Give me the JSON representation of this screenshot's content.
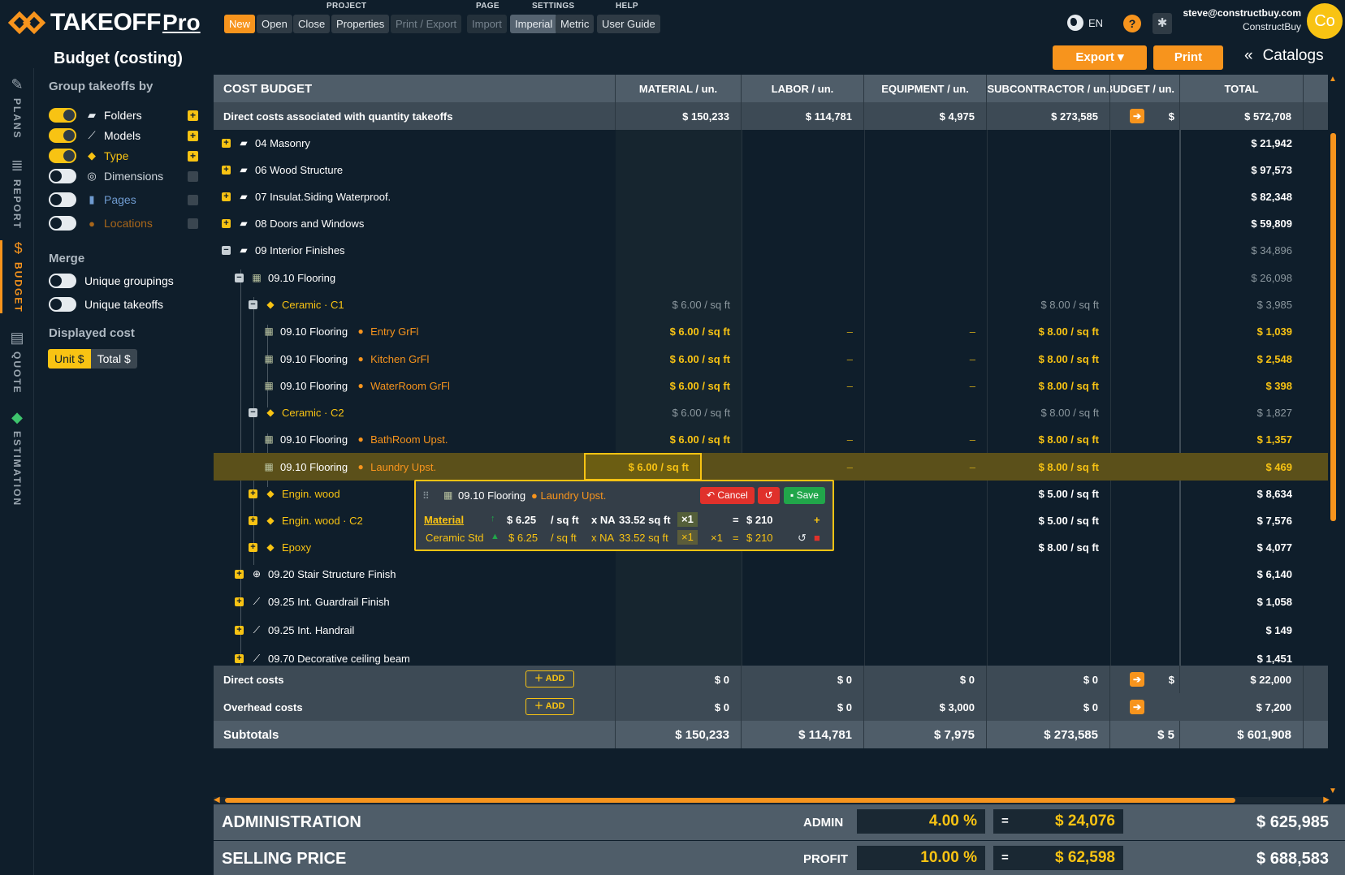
{
  "app": {
    "brand": "TAKEOFF",
    "brand_suffix": "Pro"
  },
  "menu": {
    "groups": {
      "project": "PROJECT",
      "page": "PAGE",
      "settings": "SETTINGS",
      "help": "HELP"
    },
    "buttons": {
      "new": "New",
      "open": "Open",
      "close": "Close",
      "properties": "Properties",
      "print_export": "Print / Export",
      "import": "Import",
      "imperial": "Imperial",
      "metric": "Metric",
      "user_guide": "User Guide"
    },
    "language": "EN",
    "help_glyph": "?"
  },
  "user": {
    "email": "steve@constructbuy.com",
    "company": "ConstructBuy",
    "initials": "Co"
  },
  "rail": {
    "plans": "PLANS",
    "report": "REPORT",
    "budget": "BUDGET",
    "quote": "QUOTE",
    "estimation": "ESTIMATION"
  },
  "side": {
    "title": "Budget (costing)",
    "group_by_label": "Group takeoffs by",
    "group_by": [
      {
        "label": "Folders",
        "on": true,
        "icon": "folder-icon"
      },
      {
        "label": "Models",
        "on": true,
        "icon": "model-icon"
      },
      {
        "label": "Type",
        "on": true,
        "icon": "tag-icon"
      },
      {
        "label": "Dimensions",
        "on": false,
        "icon": "dimension-icon"
      },
      {
        "label": "Pages",
        "on": false,
        "icon": "page-icon"
      },
      {
        "label": "Locations",
        "on": false,
        "icon": "location-icon"
      }
    ],
    "merge_label": "Merge",
    "merge": [
      {
        "label": "Unique groupings",
        "on": false
      },
      {
        "label": "Unique takeoffs",
        "on": false
      }
    ],
    "displayed_cost_label": "Displayed cost",
    "cost_options": [
      "Unit $",
      "Total $"
    ]
  },
  "actions": {
    "export": "Export",
    "print": "Print",
    "catalogs": "Catalogs"
  },
  "table": {
    "headers": {
      "name": "COST BUDGET",
      "material": "MATERIAL / un.",
      "labor": "LABOR / un.",
      "equipment": "EQUIPMENT / un.",
      "subcontractor": "SUBCONTRACTOR / un.",
      "budget": "BUDGET / un.",
      "total": "TOTAL"
    },
    "summary": {
      "label": "Direct costs associated with quantity takeoffs",
      "material": "$ 150,233",
      "labor": "$ 114,781",
      "equipment": "$ 4,975",
      "subcontractor": "$ 273,585",
      "budget": "$",
      "total": "$ 572,708"
    },
    "rows": [
      {
        "label": "04 Masonry",
        "total": "$ 21,942"
      },
      {
        "label": "06 Wood Structure",
        "total": "$ 97,573"
      },
      {
        "label": "07 Insulat.Siding Waterproof.",
        "total": "$ 82,348"
      },
      {
        "label": "08 Doors and Windows",
        "total": "$ 59,809"
      },
      {
        "label": "09 Interior Finishes",
        "total": "$ 34,896"
      },
      {
        "label": "09.10 Flooring",
        "total": "$ 26,098"
      },
      {
        "label": "Ceramic · C1",
        "material": "$ 6.00 / sq ft",
        "subcontractor": "$ 8.00 / sq ft",
        "total": "$ 3,985"
      },
      {
        "label": "09.10 Flooring",
        "location": "Entry GrFl",
        "material": "$ 6.00 / sq ft",
        "labor": "–",
        "equipment": "–",
        "subcontractor": "$ 8.00 / sq ft",
        "total": "$ 1,039"
      },
      {
        "label": "09.10 Flooring",
        "location": "Kitchen GrFl",
        "material": "$ 6.00 / sq ft",
        "labor": "–",
        "equipment": "–",
        "subcontractor": "$ 8.00 / sq ft",
        "total": "$ 2,548"
      },
      {
        "label": "09.10 Flooring",
        "location": "WaterRoom GrFl",
        "material": "$ 6.00 / sq ft",
        "labor": "–",
        "equipment": "–",
        "subcontractor": "$ 8.00 / sq ft",
        "total": "$ 398"
      },
      {
        "label": "Ceramic · C2",
        "material": "$ 6.00 / sq ft",
        "subcontractor": "$ 8.00 / sq ft",
        "total": "$ 1,827"
      },
      {
        "label": "09.10 Flooring",
        "location": "BathRoom Upst.",
        "material": "$ 6.00 / sq ft",
        "labor": "–",
        "equipment": "–",
        "subcontractor": "$ 8.00 / sq ft",
        "total": "$ 1,357"
      },
      {
        "label": "09.10 Flooring",
        "location": "Laundry Upst.",
        "material": "$ 6.00 / sq ft",
        "labor": "–",
        "equipment": "–",
        "subcontractor": "$ 8.00 / sq ft",
        "total": "$ 469"
      },
      {
        "label": "Engin. wood",
        "subcontractor": "$ 5.00 / sq ft",
        "total": "$ 8,634"
      },
      {
        "label": "Engin. wood · C2",
        "subcontractor": "$ 5.00 / sq ft",
        "total": "$ 7,576"
      },
      {
        "label": "Epoxy",
        "subcontractor": "$ 8.00 / sq ft",
        "total": "$ 4,077"
      },
      {
        "label": "09.20 Stair Structure Finish",
        "total": "$ 6,140"
      },
      {
        "label": "09.25 Int. Guardrail Finish",
        "total": "$ 1,058"
      },
      {
        "label": "09.25 Int. Handrail",
        "total": "$ 149"
      },
      {
        "label": "09.70 Decorative ceiling beam",
        "total": "$ 1,451"
      }
    ],
    "direct_costs": {
      "label": "Direct costs",
      "add": "ADD",
      "material": "$ 0",
      "labor": "$ 0",
      "equipment": "$ 0",
      "subcontractor": "$ 0",
      "budget": "$",
      "total": "$ 22,000"
    },
    "overhead_costs": {
      "label": "Overhead costs",
      "add": "ADD",
      "material": "$ 0",
      "labor": "$ 0",
      "equipment": "$ 3,000",
      "subcontractor": "$ 0",
      "total": "$ 7,200"
    },
    "subtotals": {
      "label": "Subtotals",
      "material": "$ 150,233",
      "labor": "$ 114,781",
      "equipment": "$ 7,975",
      "subcontractor": "$ 273,585",
      "budget": "$ 5",
      "total": "$ 601,908"
    }
  },
  "popover": {
    "title": "09.10 Flooring",
    "location": "Laundry Upst.",
    "cancel": "Cancel",
    "save": "Save",
    "main": {
      "label": "Material",
      "price": "$ 6.25",
      "unit": "/ sq ft",
      "xna": "x NA",
      "qty": "33.52 sq ft",
      "mult": "×1",
      "eq": "=",
      "total": "$ 210"
    },
    "sub": {
      "label": "Ceramic Std",
      "price": "$ 6.25",
      "unit": "/ sq ft",
      "xna": "x NA",
      "qty": "33.52 sq ft",
      "mult": "×1",
      "mult2": "×1",
      "eq": "=",
      "total": "$ 210"
    }
  },
  "totals": {
    "administration": {
      "label": "ADMINISTRATION",
      "short": "ADMIN",
      "pct": "4.00 %",
      "eq": "=",
      "amount": "$ 24,076",
      "total": "$ 625,985"
    },
    "selling": {
      "label": "SELLING PRICE",
      "short": "PROFIT",
      "pct": "10.00 %",
      "eq": "=",
      "amount": "$ 62,598",
      "total": "$ 688,583"
    }
  },
  "colors": {
    "accent": "#f7941d",
    "highlight": "#f8c313",
    "background": "#0f1e2b",
    "header": "#4f5d69"
  }
}
